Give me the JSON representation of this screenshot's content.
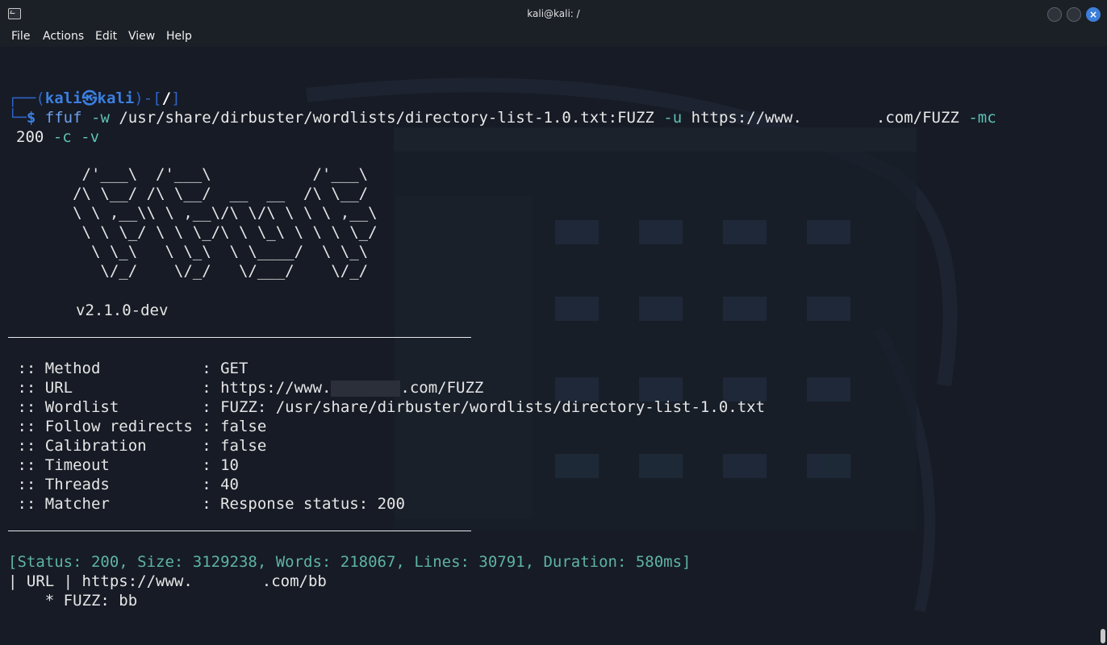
{
  "window": {
    "title": "kali@kali: /",
    "close_symbol": "×",
    "buttons": [
      "minimize",
      "maximize",
      "close"
    ]
  },
  "menu": [
    "File",
    "Actions",
    "Edit",
    "View",
    "Help"
  ],
  "prompt": {
    "corner_top": "┌──(",
    "user": "kali㉿kali",
    "path_open": ")-[",
    "path": "/",
    "path_close": "]",
    "corner_bottom": "└─",
    "dollar": "$"
  },
  "command": {
    "program": "ffuf",
    "flag_w": "-w",
    "wordlist": "/usr/share/dirbuster/wordlists/directory-list-1.0.txt:FUZZ",
    "flag_u": "-u",
    "url_prefix": "https://www.",
    "url_suffix": ".com/FUZZ",
    "flag_mc": "-mc",
    "mc_value": "200",
    "flag_c": "-c",
    "flag_v": "-v"
  },
  "banner": [
    "        /'___\\  /'___\\           /'___\\",
    "       /\\ \\__/ /\\ \\__/  __  __  /\\ \\__/",
    "       \\ \\ ,__\\\\ \\ ,__\\/\\ \\/\\ \\ \\ \\ ,__\\",
    "        \\ \\ \\_/ \\ \\ \\_/\\ \\ \\_\\ \\ \\ \\ \\_/",
    "         \\ \\_\\   \\ \\_\\  \\ \\____/  \\ \\_\\",
    "          \\/_/    \\/_/   \\/___/    \\/_/"
  ],
  "version": "v2.1.0-dev",
  "config": [
    {
      "key": " :: Method           : ",
      "value": "GET"
    },
    {
      "key": " :: URL              : ",
      "value": "https://www."
    },
    {
      "key": " :: Wordlist         : ",
      "value": "FUZZ: /usr/share/dirbuster/wordlists/directory-list-1.0.txt"
    },
    {
      "key": " :: Follow redirects : ",
      "value": "false"
    },
    {
      "key": " :: Calibration      : ",
      "value": "false"
    },
    {
      "key": " :: Timeout          : ",
      "value": "10"
    },
    {
      "key": " :: Threads          : ",
      "value": "40"
    },
    {
      "key": " :: Matcher          : ",
      "value": "Response status: 200"
    }
  ],
  "config_url_suffix": ".com/FUZZ",
  "result": {
    "status_line": "[Status: 200, Size: 3129238, Words: 218067, Lines: 30791, Duration: 580ms]",
    "url_label": "| URL | https://www.",
    "url_suffix": ".com/bb",
    "fuzz_line": "    * FUZZ: bb"
  },
  "colors": {
    "background": "#161b25",
    "prompt": "#3b7fe0",
    "flags": "#5fc1b6",
    "status": "#5fb3a6"
  }
}
